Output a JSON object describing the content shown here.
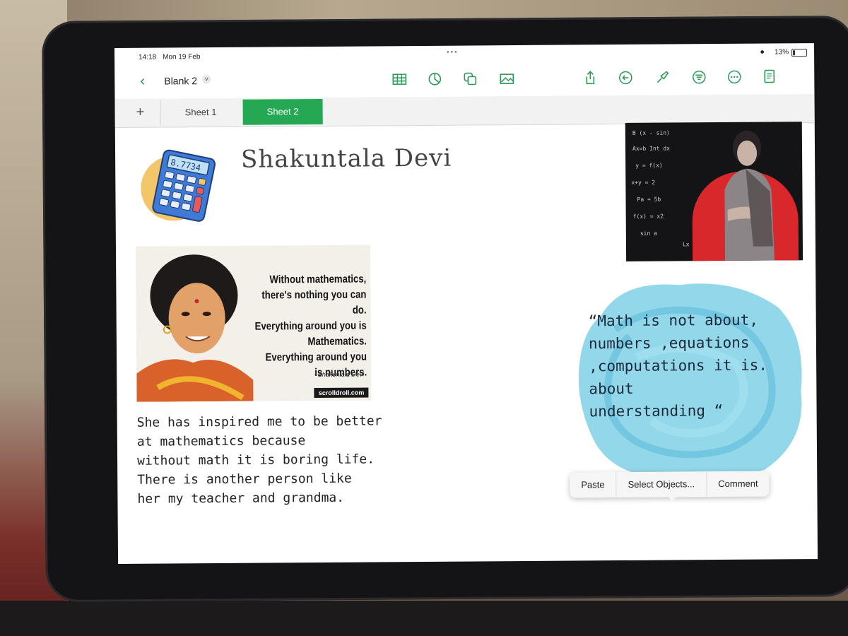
{
  "status_bar": {
    "time": "14:18",
    "date": "Mon 19 Feb",
    "battery": "13%"
  },
  "toolbar": {
    "back_icon": "chevron-left-icon",
    "doc_title": "Blank 2",
    "title_menu_icon": "chevron-down-icon",
    "center_icons": [
      "table-icon",
      "chart-icon",
      "shapes-icon",
      "media-icon"
    ],
    "right_icons": [
      "share-icon",
      "undo-icon",
      "format-brush-icon",
      "organize-icon",
      "more-icon",
      "document-icon"
    ],
    "accent_color": "#24a853"
  },
  "tabs": {
    "add_icon": "plus-icon",
    "items": [
      {
        "label": "Sheet 1",
        "active": false
      },
      {
        "label": "Sheet 2",
        "active": true
      }
    ]
  },
  "sheet": {
    "title": "Shakuntala Devi",
    "calculator_image": "calculator-illustration",
    "calculator_display": "8.7734",
    "quote_image": {
      "lines": [
        "Without mathematics,",
        "there's nothing you can do.",
        "Everything around you is",
        "Mathematics.",
        "Everything around you",
        "is numbers."
      ],
      "attribution": "- Shakuntala Devi",
      "brand": "scrolldroll.com"
    },
    "paragraph": [
      "She has inspired me to be better",
      "at mathematics because",
      "without math it is boring life.",
      "There is another person like",
      "her my teacher and grandma."
    ],
    "photo_equations": [
      "B  (x - sin)",
      "Ax=b  Int dx",
      "y = f(x)",
      "x+y = 2",
      "Pa + 5b",
      "f(x) = x2",
      "sin a",
      "Lx + Ly"
    ],
    "bubble_lines": [
      "“Math is not about,",
      "numbers   ,equations",
      ",computations it is.",
      "about",
      "understanding “"
    ],
    "bubble_color": "#7fd0e6"
  },
  "context_menu": {
    "items": [
      "Paste",
      "Select Objects...",
      "Comment"
    ]
  }
}
